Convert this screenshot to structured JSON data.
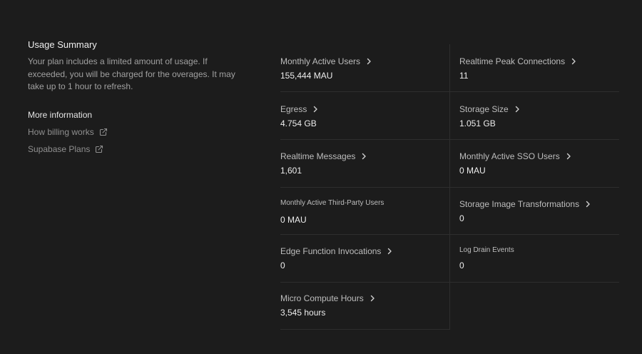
{
  "summary": {
    "title": "Usage Summary",
    "description": "Your plan includes a limited amount of usage. If exceeded, you will be charged for the overages. It may take up to 1 hour to refresh.",
    "more_title": "More information",
    "links": [
      {
        "label": "How billing works",
        "icon": "external-link-icon"
      },
      {
        "label": "Supabase Plans",
        "icon": "external-link-icon"
      }
    ]
  },
  "metrics": {
    "monthly_active_users": {
      "label": "Monthly Active Users",
      "value": "155,444 MAU"
    },
    "realtime_peak_connections": {
      "label": "Realtime Peak Connections",
      "value": "11"
    },
    "egress": {
      "label": "Egress",
      "value": "4.754 GB"
    },
    "storage_size": {
      "label": "Storage Size",
      "value": "1.051 GB"
    },
    "realtime_messages": {
      "label": "Realtime Messages",
      "value": "1,601"
    },
    "monthly_active_sso_users": {
      "label": "Monthly Active SSO Users",
      "value": "0 MAU"
    },
    "monthly_active_third_party_users": {
      "label": "Monthly Active Third-Party Users",
      "value": "0 MAU"
    },
    "storage_image_transformations": {
      "label": "Storage Image Transformations",
      "value": "0"
    },
    "edge_function_invocations": {
      "label": "Edge Function Invocations",
      "value": "0"
    },
    "log_drain_events": {
      "label": "Log Drain Events",
      "value": "0"
    },
    "micro_compute_hours": {
      "label": "Micro Compute Hours",
      "value": "3,545 hours"
    }
  },
  "colors": {
    "background": "#1c1c1c",
    "divider": "#2e2e2e",
    "text_primary": "#ededed",
    "text_muted": "#a0a0a0"
  }
}
